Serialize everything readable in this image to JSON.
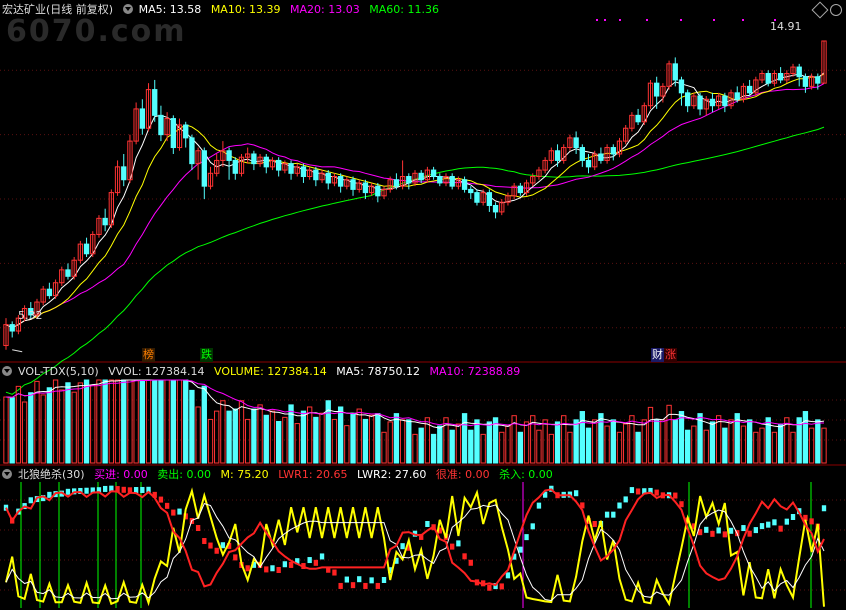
{
  "watermark": "6070.com",
  "main": {
    "title": "宏达矿业(日线 前复权)",
    "ma5_label": "MA5: 13.58",
    "ma10_label": "MA10: 13.39",
    "ma20_label": "MA20: 13.03",
    "ma60_label": "MA60: 11.36",
    "high_label": "14.91",
    "low_label": "5.32",
    "tags": [
      "榜",
      "跌",
      "财",
      "涨"
    ],
    "colors": {
      "ma5": "#ffffff",
      "ma10": "#ffff00",
      "ma20": "#ff00ff",
      "ma60": "#00ff00",
      "up": "#ff3333",
      "down": "#54ffff"
    }
  },
  "vol": {
    "title": "VOL-TDX(5,10)",
    "vvol_label": "VVOL: 127384.14",
    "volume_label": "VOLUME: 127384.14",
    "ma5_label": "MA5: 78750.12",
    "ma10_label": "MA10: 72388.89"
  },
  "ind": {
    "title": "北狼绝杀(30)",
    "buy_label": "买进: 0.00",
    "sell_label": "卖出: 0.00",
    "m_label": "M: 75.20",
    "lwr1_label": "LWR1: 20.65",
    "lwr2_label": "LWR2: 27.60",
    "hen_label": "很准: 0.00",
    "sha_label": "杀入: 0.00"
  },
  "chart_data": [
    {
      "type": "candlestick",
      "title": "宏达矿业(日线 前复权)",
      "ylim": [
        5,
        15.5
      ],
      "annotations": [
        {
          "text": "14.91",
          "x": 148,
          "y": 14.91
        },
        {
          "text": "5.32",
          "x": 1,
          "y": 5.32
        }
      ],
      "candles": [
        [
          5.45,
          6.1,
          6.3,
          5.32
        ],
        [
          6.1,
          5.9,
          6.2,
          5.7
        ],
        [
          5.9,
          6.3,
          6.4,
          5.8
        ],
        [
          6.3,
          6.6,
          6.7,
          6.2
        ],
        [
          6.6,
          6.4,
          6.8,
          6.3
        ],
        [
          6.4,
          6.8,
          6.9,
          6.3
        ],
        [
          6.8,
          7.2,
          7.3,
          6.7
        ],
        [
          7.2,
          7.0,
          7.4,
          6.9
        ],
        [
          7.0,
          7.4,
          7.5,
          6.9
        ],
        [
          7.4,
          7.8,
          7.9,
          7.3
        ],
        [
          7.8,
          7.6,
          8.0,
          7.5
        ],
        [
          7.6,
          8.1,
          8.2,
          7.5
        ],
        [
          8.1,
          8.6,
          8.7,
          8.0
        ],
        [
          8.6,
          8.3,
          8.8,
          8.2
        ],
        [
          8.3,
          8.9,
          9.0,
          8.2
        ],
        [
          8.9,
          9.4,
          9.5,
          8.8
        ],
        [
          9.4,
          9.2,
          9.7,
          9.0
        ],
        [
          9.2,
          10.2,
          10.3,
          9.1
        ],
        [
          10.2,
          11.0,
          11.2,
          10.1
        ],
        [
          11.0,
          10.6,
          11.4,
          10.4
        ],
        [
          10.6,
          11.8,
          12.0,
          10.5
        ],
        [
          11.8,
          12.8,
          13.0,
          11.7
        ],
        [
          12.8,
          12.2,
          13.1,
          12.0
        ],
        [
          12.2,
          13.4,
          13.6,
          12.1
        ],
        [
          13.4,
          12.6,
          13.7,
          12.4
        ],
        [
          12.6,
          12.0,
          12.9,
          11.8
        ],
        [
          12.0,
          12.5,
          12.7,
          11.8
        ],
        [
          12.5,
          11.6,
          12.6,
          11.4
        ],
        [
          11.6,
          12.3,
          12.5,
          11.5
        ],
        [
          12.3,
          11.9,
          12.4,
          11.6
        ],
        [
          11.9,
          11.1,
          12.0,
          10.9
        ],
        [
          11.1,
          11.5,
          11.6,
          10.6
        ],
        [
          11.5,
          10.4,
          11.6,
          10.0
        ],
        [
          10.4,
          10.8,
          11.0,
          10.3
        ],
        [
          10.8,
          11.2,
          11.4,
          10.7
        ],
        [
          11.2,
          11.5,
          11.8,
          11.0
        ],
        [
          11.5,
          11.2,
          11.6,
          10.6
        ],
        [
          11.2,
          10.8,
          11.3,
          10.6
        ],
        [
          10.8,
          11.3,
          11.4,
          10.7
        ],
        [
          11.3,
          11.4,
          11.6,
          11.1
        ],
        [
          11.4,
          11.1,
          11.5,
          10.9
        ],
        [
          11.1,
          11.3,
          11.4,
          11.0
        ],
        [
          11.3,
          11.0,
          11.4,
          10.8
        ],
        [
          11.0,
          11.2,
          11.3,
          10.9
        ],
        [
          11.2,
          10.9,
          11.3,
          10.7
        ],
        [
          10.9,
          11.1,
          11.2,
          10.8
        ],
        [
          11.1,
          10.8,
          11.2,
          10.6
        ],
        [
          10.8,
          11.0,
          11.1,
          10.7
        ],
        [
          11.0,
          10.7,
          11.1,
          10.5
        ],
        [
          10.7,
          10.9,
          11.0,
          10.6
        ],
        [
          10.9,
          10.6,
          11.0,
          10.4
        ],
        [
          10.6,
          10.8,
          10.9,
          10.5
        ],
        [
          10.8,
          10.5,
          10.9,
          10.3
        ],
        [
          10.5,
          10.7,
          10.8,
          10.4
        ],
        [
          10.7,
          10.4,
          10.8,
          10.2
        ],
        [
          10.4,
          10.6,
          10.7,
          10.3
        ],
        [
          10.6,
          10.3,
          10.7,
          10.1
        ],
        [
          10.3,
          10.5,
          10.6,
          10.2
        ],
        [
          10.5,
          10.2,
          10.6,
          10.0
        ],
        [
          10.2,
          10.4,
          10.5,
          10.1
        ],
        [
          10.4,
          10.1,
          10.5,
          9.9
        ],
        [
          10.1,
          10.3,
          10.4,
          10.0
        ],
        [
          10.3,
          10.6,
          10.7,
          10.2
        ],
        [
          10.6,
          10.4,
          10.8,
          10.3
        ],
        [
          10.4,
          10.7,
          11.2,
          10.3
        ],
        [
          10.7,
          10.5,
          10.8,
          10.3
        ],
        [
          10.5,
          10.8,
          10.9,
          10.4
        ],
        [
          10.8,
          10.6,
          10.9,
          10.5
        ],
        [
          10.6,
          10.9,
          11.0,
          10.5
        ],
        [
          10.9,
          10.7,
          11.0,
          10.6
        ],
        [
          10.7,
          10.5,
          10.8,
          10.4
        ],
        [
          10.5,
          10.7,
          10.8,
          10.4
        ],
        [
          10.7,
          10.4,
          10.8,
          10.3
        ],
        [
          10.4,
          10.6,
          10.7,
          10.3
        ],
        [
          10.6,
          10.3,
          10.7,
          10.2
        ],
        [
          10.3,
          10.2,
          10.4,
          10.0
        ],
        [
          10.2,
          9.9,
          10.3,
          9.8
        ],
        [
          9.9,
          10.2,
          10.3,
          9.8
        ],
        [
          10.2,
          9.8,
          10.3,
          9.6
        ],
        [
          9.8,
          9.6,
          9.9,
          9.4
        ],
        [
          9.6,
          9.9,
          10.0,
          9.5
        ],
        [
          9.9,
          10.1,
          10.2,
          9.8
        ],
        [
          10.1,
          10.4,
          10.5,
          10.0
        ],
        [
          10.4,
          10.2,
          10.5,
          10.1
        ],
        [
          10.2,
          10.5,
          10.6,
          10.1
        ],
        [
          10.5,
          10.7,
          10.8,
          10.4
        ],
        [
          10.7,
          10.9,
          11.0,
          10.6
        ],
        [
          10.9,
          11.2,
          11.3,
          10.8
        ],
        [
          11.2,
          11.5,
          11.6,
          11.1
        ],
        [
          11.5,
          11.2,
          11.7,
          11.0
        ],
        [
          11.2,
          11.6,
          11.7,
          11.1
        ],
        [
          11.6,
          11.9,
          12.0,
          11.5
        ],
        [
          11.9,
          11.6,
          12.1,
          11.4
        ],
        [
          11.6,
          11.2,
          11.7,
          11.0
        ],
        [
          11.2,
          11.0,
          11.4,
          10.8
        ],
        [
          11.0,
          11.4,
          11.5,
          10.9
        ],
        [
          11.4,
          11.2,
          11.6,
          11.1
        ],
        [
          11.2,
          11.6,
          11.7,
          11.1
        ],
        [
          11.6,
          11.4,
          11.7,
          11.2
        ],
        [
          11.4,
          11.8,
          11.9,
          11.3
        ],
        [
          11.8,
          12.2,
          12.3,
          11.7
        ],
        [
          12.2,
          12.6,
          12.7,
          12.1
        ],
        [
          12.6,
          12.4,
          12.8,
          12.3
        ],
        [
          12.4,
          12.9,
          13.0,
          12.3
        ],
        [
          12.9,
          13.6,
          13.7,
          12.8
        ],
        [
          13.6,
          13.2,
          13.8,
          12.8
        ],
        [
          13.2,
          13.5,
          13.6,
          13.0
        ],
        [
          13.5,
          14.2,
          14.3,
          13.4
        ],
        [
          14.2,
          13.7,
          14.4,
          13.5
        ],
        [
          13.7,
          13.3,
          13.8,
          12.9
        ],
        [
          13.3,
          12.9,
          13.4,
          12.7
        ],
        [
          12.9,
          13.2,
          13.3,
          12.8
        ],
        [
          13.2,
          12.8,
          13.3,
          12.6
        ],
        [
          12.8,
          13.1,
          13.2,
          12.6
        ],
        [
          13.1,
          12.9,
          13.3,
          12.7
        ],
        [
          12.9,
          13.2,
          13.3,
          12.8
        ],
        [
          13.2,
          12.9,
          13.3,
          12.7
        ],
        [
          12.9,
          13.3,
          13.4,
          12.8
        ],
        [
          13.3,
          13.1,
          13.5,
          13.0
        ],
        [
          13.1,
          13.5,
          13.6,
          13.0
        ],
        [
          13.5,
          13.3,
          13.7,
          13.2
        ],
        [
          13.3,
          13.7,
          13.8,
          13.2
        ],
        [
          13.7,
          13.9,
          14.0,
          13.6
        ],
        [
          13.9,
          13.6,
          14.0,
          13.5
        ],
        [
          13.6,
          13.9,
          14.0,
          13.5
        ],
        [
          13.9,
          13.7,
          14.1,
          13.6
        ],
        [
          13.7,
          13.9,
          14.0,
          13.6
        ],
        [
          13.9,
          14.1,
          14.2,
          13.8
        ],
        [
          14.1,
          13.8,
          14.2,
          13.5
        ],
        [
          13.8,
          13.5,
          13.9,
          13.3
        ],
        [
          13.5,
          13.8,
          13.9,
          13.4
        ],
        [
          13.8,
          13.6,
          13.9,
          13.4
        ],
        [
          13.6,
          14.91,
          14.91,
          13.6
        ]
      ],
      "ma": {
        "ma5_last": 13.58,
        "ma10_last": 13.39,
        "ma20_last": 13.03,
        "ma60_last": 11.36
      }
    },
    {
      "type": "bar",
      "title": "VOL-TDX(5,10)",
      "last_values": {
        "VVOL": 127384.14,
        "VOLUME": 127384.14,
        "MA5": 78750.12,
        "MA10": 72388.89
      }
    },
    {
      "type": "line",
      "title": "北狼绝杀(30)",
      "ylim": [
        0,
        100
      ],
      "last_values": {
        "M": 75.2,
        "LWR1": 20.65,
        "LWR2": 27.6
      }
    }
  ]
}
